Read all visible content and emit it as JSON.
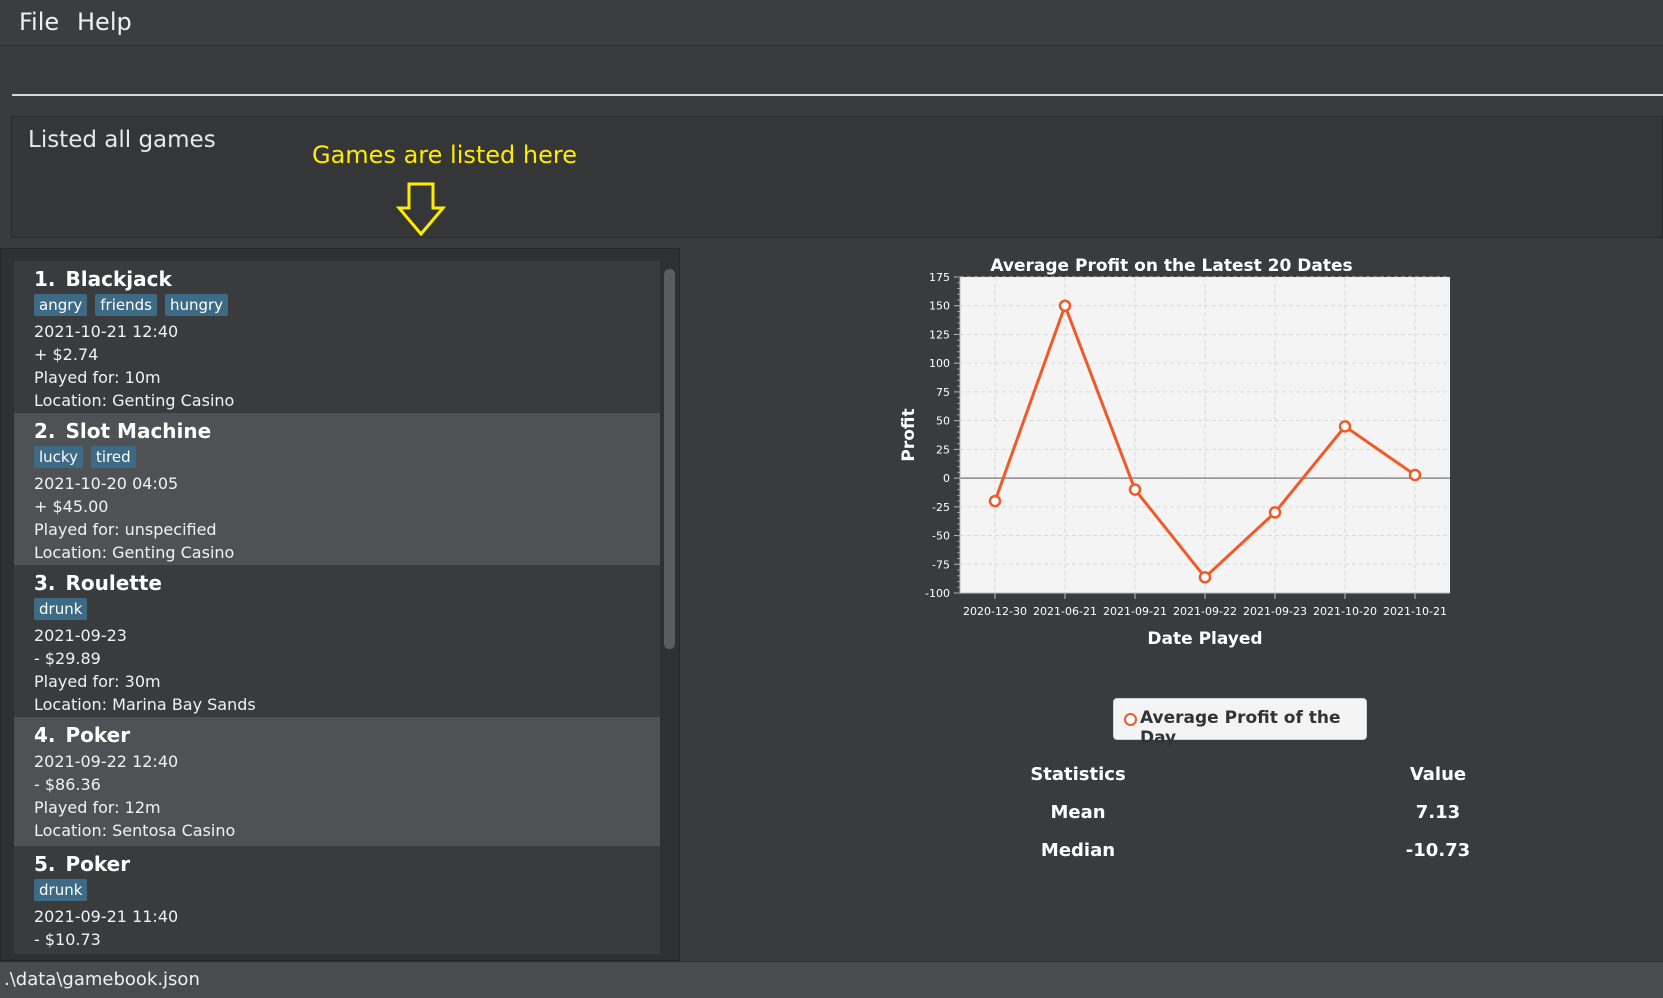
{
  "menu": {
    "file": "File",
    "help": "Help"
  },
  "command": {
    "value": ""
  },
  "result": {
    "text": "Listed all games"
  },
  "annotation": {
    "text": "Games are listed here",
    "color": "#ffeb00"
  },
  "games": [
    {
      "index": "1.",
      "name": "Blackjack",
      "tags": [
        "angry",
        "friends",
        "hungry"
      ],
      "datetime": "2021-10-21 12:40",
      "profit": "+ $2.74",
      "duration": "Played for: 10m",
      "location": "Location: Genting Casino"
    },
    {
      "index": "2.",
      "name": "Slot Machine",
      "tags": [
        "lucky",
        "tired"
      ],
      "datetime": "2021-10-20 04:05",
      "profit": "+ $45.00",
      "duration": "Played for: unspecified",
      "location": "Location: Genting Casino"
    },
    {
      "index": "3.",
      "name": "Roulette",
      "tags": [
        "drunk"
      ],
      "datetime": "2021-09-23",
      "profit": "- $29.89",
      "duration": "Played for: 30m",
      "location": "Location: Marina Bay Sands"
    },
    {
      "index": "4.",
      "name": "Poker",
      "tags": [],
      "datetime": "2021-09-22 12:40",
      "profit": "- $86.36",
      "duration": "Played for: 12m",
      "location": "Location: Sentosa Casino"
    },
    {
      "index": "5.",
      "name": "Poker",
      "tags": [
        "drunk"
      ],
      "datetime": "2021-09-21 11:40",
      "profit": "- $10.73",
      "duration": "",
      "location": ""
    }
  ],
  "chart_data": {
    "type": "line",
    "title": "Average Profit on the Latest 20 Dates",
    "xlabel": "Date Played",
    "ylabel": "Profit",
    "categories": [
      "2020-12-30",
      "2021-06-21",
      "2021-09-21",
      "2021-09-22",
      "2021-09-23",
      "2021-10-20",
      "2021-10-21"
    ],
    "series": [
      {
        "name": "Average Profit of the Day",
        "values": [
          -20,
          150,
          -10,
          -86.36,
          -29.89,
          45,
          2.74
        ],
        "color": "#f05a28"
      }
    ],
    "ylim": [
      -100,
      175
    ],
    "yticks": [
      175,
      150,
      125,
      100,
      75,
      50,
      25,
      0,
      -25,
      -50,
      -75,
      -100
    ],
    "grid": true,
    "legend": "bottom"
  },
  "statistics": {
    "header": {
      "label": "Statistics",
      "value": "Value"
    },
    "rows": [
      {
        "label": "Mean",
        "value": "7.13"
      },
      {
        "label": "Median",
        "value": "-10.73"
      }
    ]
  },
  "status": {
    "path": ".\\data\\gamebook.json"
  }
}
